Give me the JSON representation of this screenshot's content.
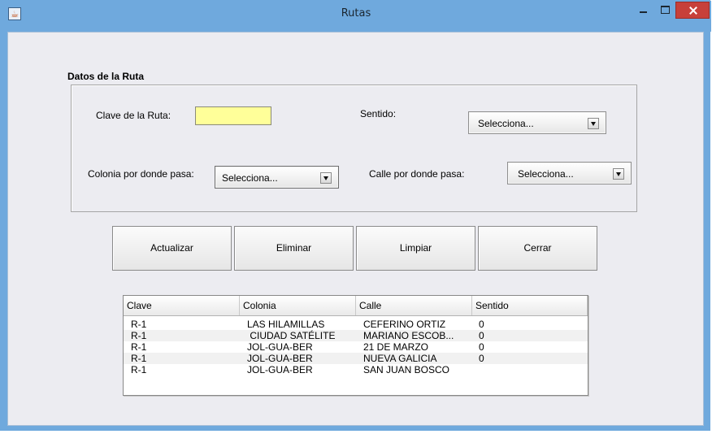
{
  "window": {
    "title": "Rutas",
    "app_icon": "java-cup-icon"
  },
  "form": {
    "section_title": "Datos de la Ruta",
    "clave_label": "Clave de la Ruta:",
    "clave_value": "",
    "sentido_label": "Sentido:",
    "sentido_value": "Selecciona...",
    "colonia_label": "Colonia por donde pasa:",
    "colonia_value": "Selecciona...",
    "calle_label": "Calle por donde pasa:",
    "calle_value": "Selecciona..."
  },
  "buttons": {
    "actualizar": "Actualizar",
    "eliminar": "Eliminar",
    "limpiar": "Limpiar",
    "cerrar": "Cerrar"
  },
  "table": {
    "headers": [
      "Clave",
      "Colonia",
      "Calle",
      "Sentido"
    ],
    "rows": [
      [
        "R-1",
        "LAS HILAMILLAS",
        "CEFERINO ORTIZ",
        "0"
      ],
      [
        "R-1",
        " CIUDAD SATÉLITE",
        "MARIANO ESCOB...",
        "0"
      ],
      [
        "R-1",
        "JOL-GUA-BER",
        "21 DE MARZO",
        "0"
      ],
      [
        "R-1",
        "JOL-GUA-BER",
        "NUEVA GALICIA",
        "0"
      ],
      [
        "R-1",
        "JOL-GUA-BER",
        "SAN JUAN BOSCO",
        ""
      ]
    ]
  },
  "colors": {
    "titlebar": "#6fa9dd",
    "close": "#c7403a",
    "field_highlight": "#ffff99",
    "background": "#ececf1"
  }
}
